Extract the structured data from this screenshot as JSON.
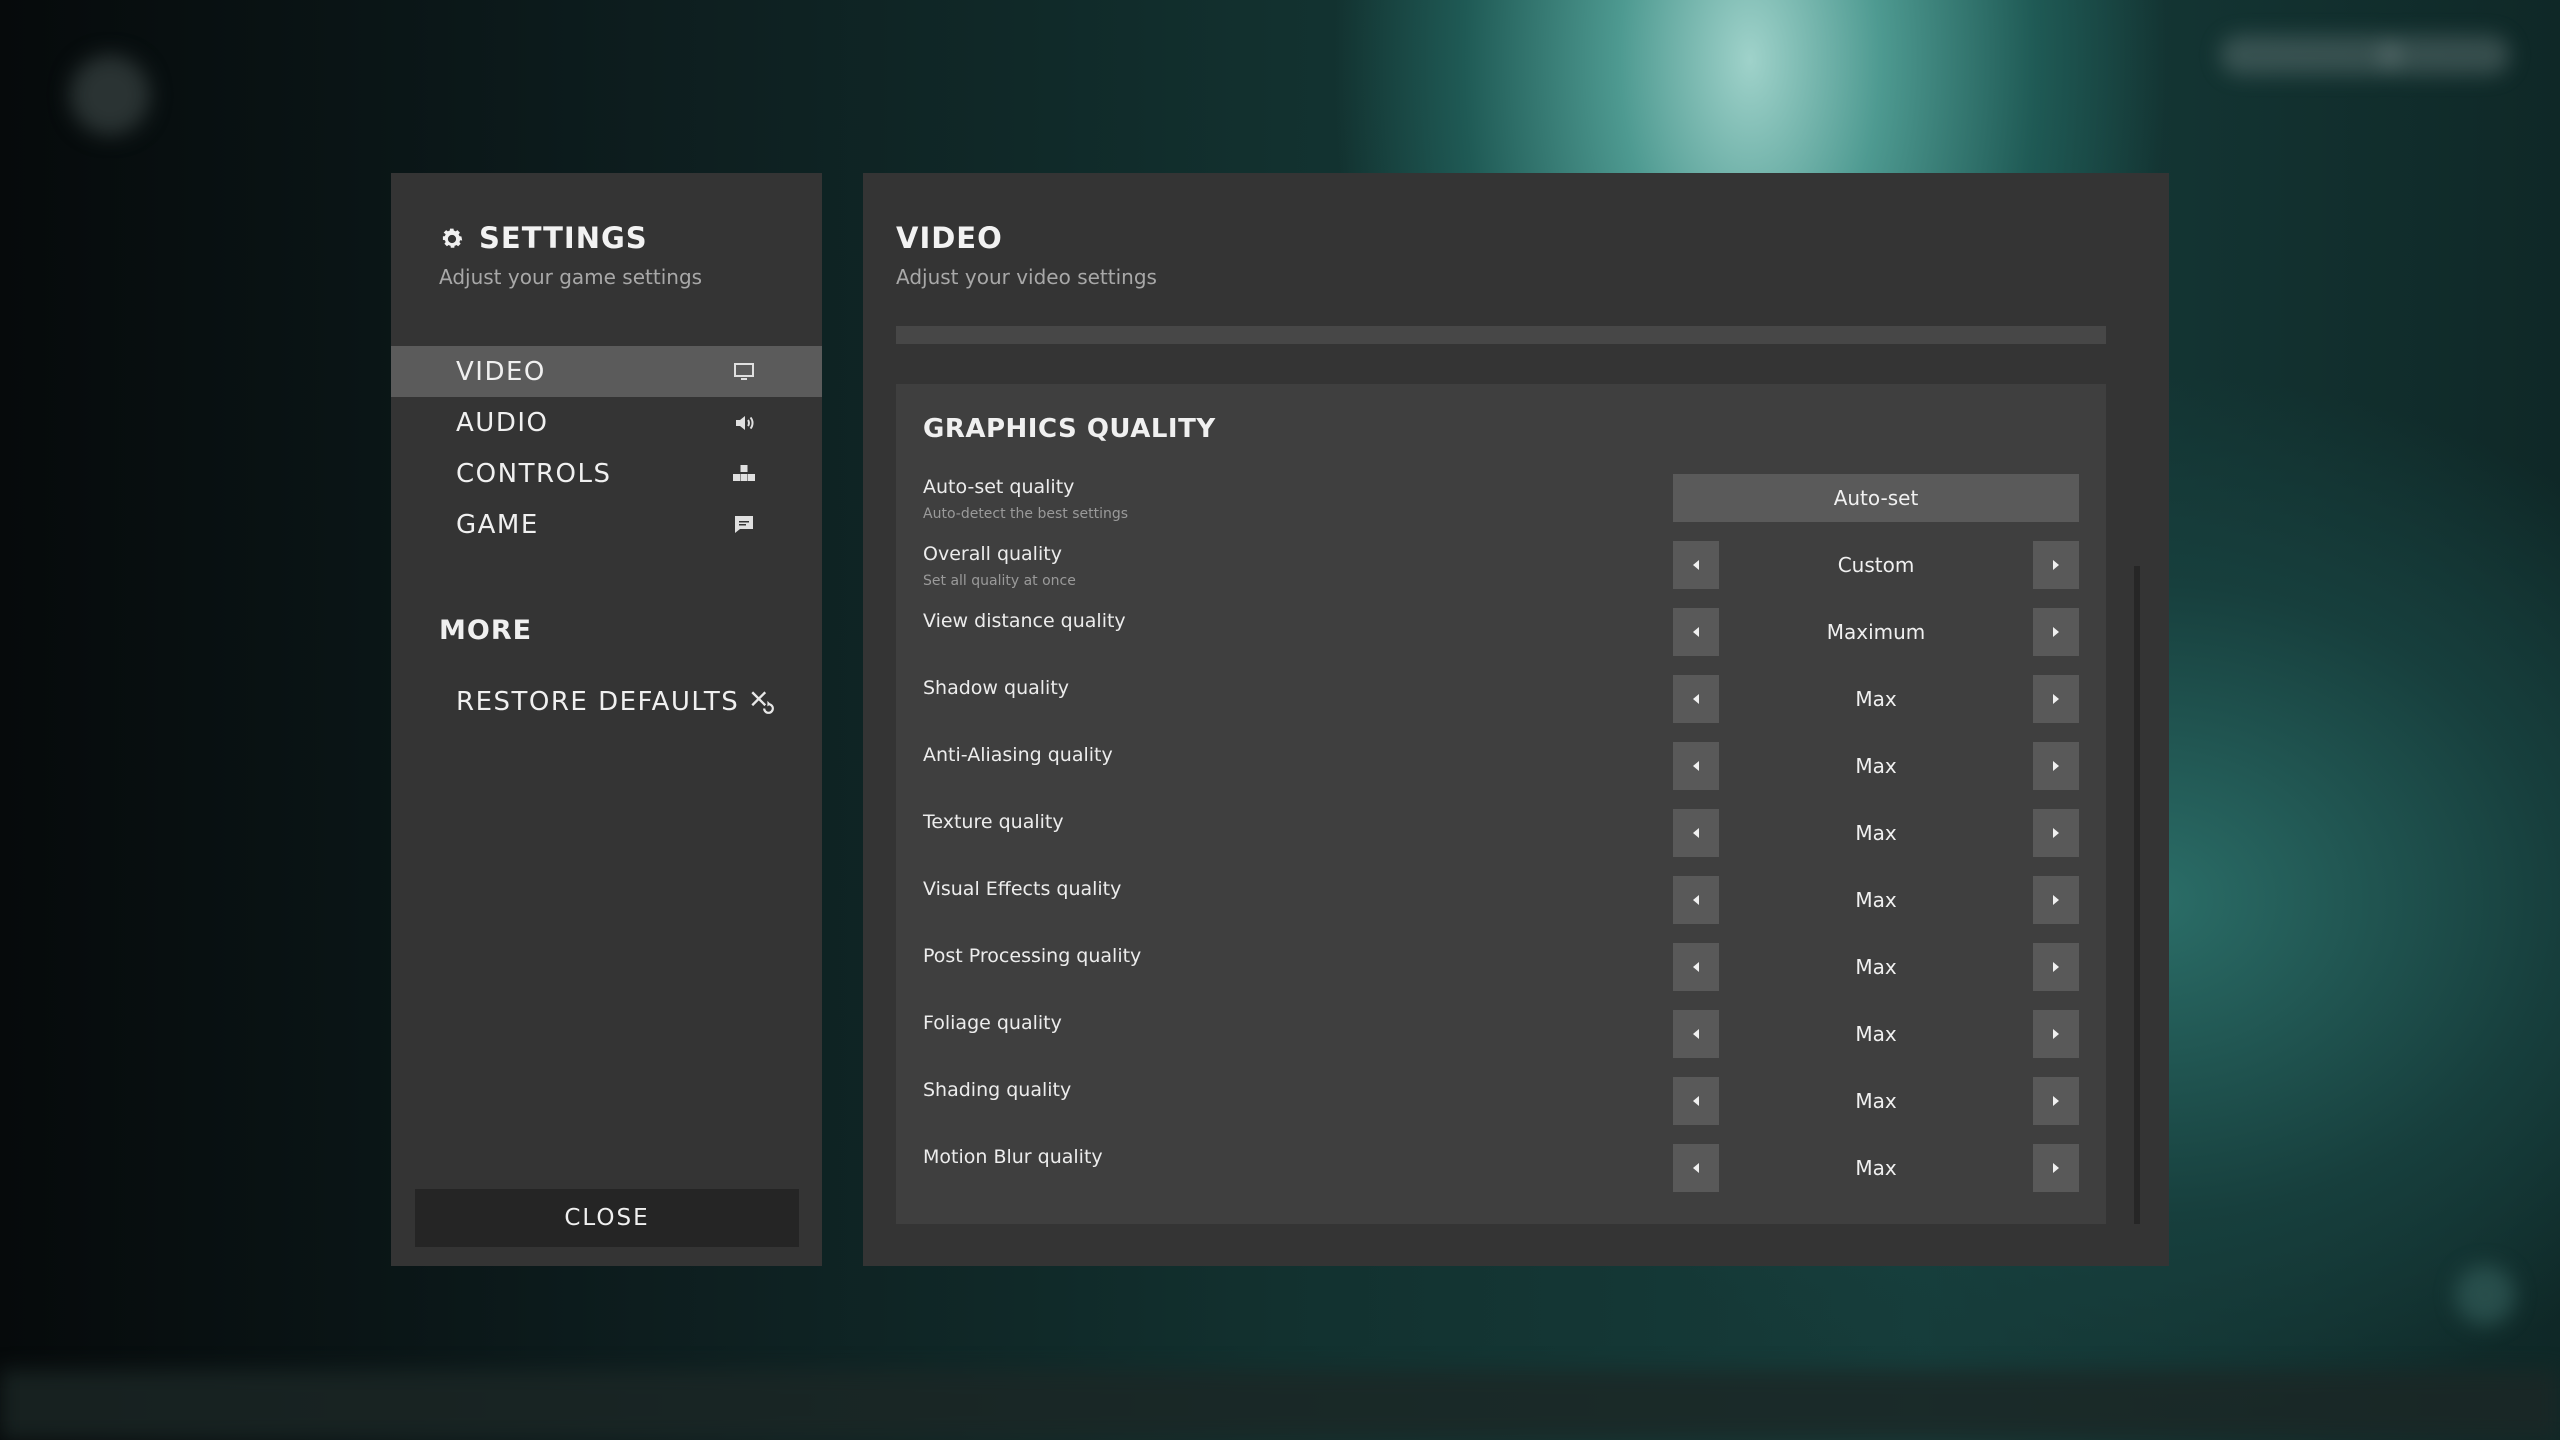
{
  "settings": {
    "title": "SETTINGS",
    "subtitle": "Adjust your game settings",
    "nav": [
      {
        "label": "VIDEO",
        "icon": "monitor-icon",
        "active": true
      },
      {
        "label": "AUDIO",
        "icon": "speaker-icon",
        "active": false
      },
      {
        "label": "CONTROLS",
        "icon": "controls-icon",
        "active": false
      },
      {
        "label": "GAME",
        "icon": "chat-icon",
        "active": false
      }
    ],
    "more_title": "MORE",
    "restore_label": "RESTORE DEFAULTS",
    "close_label": "CLOSE"
  },
  "video": {
    "title": "VIDEO",
    "subtitle": "Adjust your video settings",
    "section_title": "GRAPHICS QUALITY",
    "rows": [
      {
        "label": "Auto-set quality",
        "desc": "Auto-detect the best settings",
        "type": "button",
        "value": "Auto-set"
      },
      {
        "label": "Overall quality",
        "desc": "Set all quality at once",
        "type": "selector",
        "value": "Custom"
      },
      {
        "label": "View distance quality",
        "desc": "",
        "type": "selector",
        "value": "Maximum"
      },
      {
        "label": "Shadow quality",
        "desc": "",
        "type": "selector",
        "value": "Max"
      },
      {
        "label": "Anti-Aliasing quality",
        "desc": "",
        "type": "selector",
        "value": "Max"
      },
      {
        "label": "Texture quality",
        "desc": "",
        "type": "selector",
        "value": "Max"
      },
      {
        "label": "Visual Effects quality",
        "desc": "",
        "type": "selector",
        "value": "Max"
      },
      {
        "label": "Post Processing quality",
        "desc": "",
        "type": "selector",
        "value": "Max"
      },
      {
        "label": "Foliage quality",
        "desc": "",
        "type": "selector",
        "value": "Max"
      },
      {
        "label": "Shading quality",
        "desc": "",
        "type": "selector",
        "value": "Max"
      },
      {
        "label": "Motion Blur quality",
        "desc": "",
        "type": "selector",
        "value": "Max"
      }
    ]
  },
  "colors": {
    "panel": "#343434",
    "active_nav": "#5b5b5b",
    "section": "#3f3f3f",
    "button": "#5a5a5a"
  }
}
